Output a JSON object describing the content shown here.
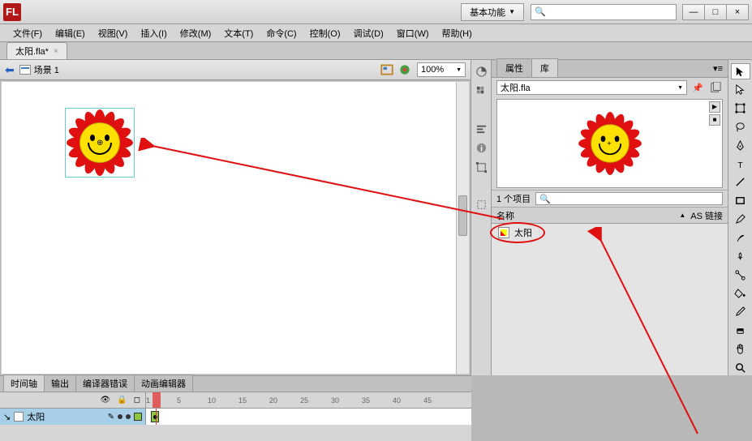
{
  "app": {
    "logo": "FL",
    "workspace": "基本功能"
  },
  "window_buttons": {
    "min": "—",
    "max": "□",
    "close": "×"
  },
  "menu": [
    "文件(F)",
    "编辑(E)",
    "视图(V)",
    "插入(I)",
    "修改(M)",
    "文本(T)",
    "命令(C)",
    "控制(O)",
    "调试(D)",
    "窗口(W)",
    "帮助(H)"
  ],
  "doc_tab": {
    "name": "太阳.fla*",
    "close": "×"
  },
  "stage_bar": {
    "scene": "场景 1",
    "zoom": "100%"
  },
  "panel": {
    "tabs": {
      "props": "属性",
      "lib": "库"
    },
    "doc": "太阳.fla",
    "count": "1 个项目",
    "cols": {
      "name": "名称",
      "as": "AS 链接"
    },
    "item": "太阳"
  },
  "bottom": {
    "tabs": {
      "timeline": "时间轴",
      "output": "输出",
      "errors": "编译器错误",
      "motion": "动画编辑器"
    },
    "layer": "太阳",
    "frames": [
      "1",
      "5",
      "10",
      "15",
      "20",
      "25",
      "30",
      "35",
      "40",
      "45"
    ]
  }
}
